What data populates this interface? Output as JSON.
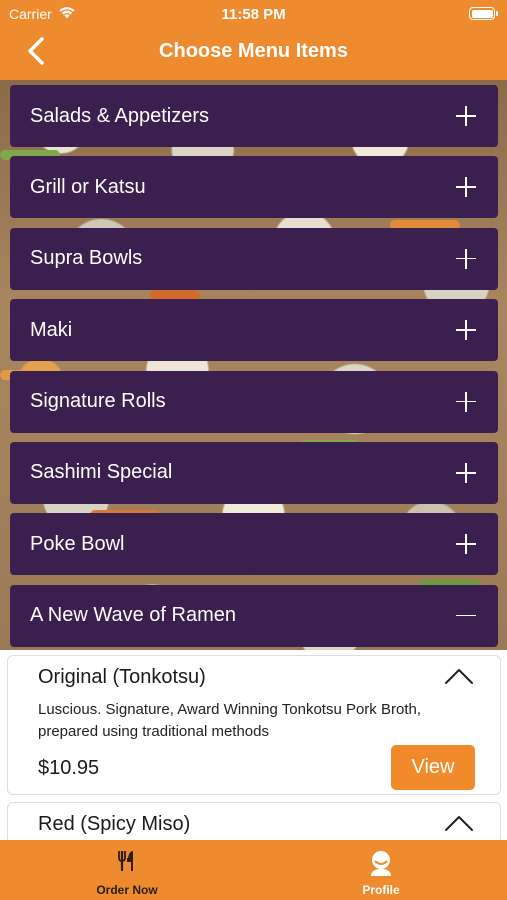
{
  "status_bar": {
    "carrier": "Carrier",
    "time": "11:58 PM"
  },
  "nav": {
    "title": "Choose Menu Items",
    "back_icon": "chevron-left-icon"
  },
  "categories": [
    {
      "label": "Salads & Appetizers",
      "state": "collapsed"
    },
    {
      "label": "Grill or Katsu",
      "state": "collapsed"
    },
    {
      "label": "Supra Bowls",
      "state": "collapsed"
    },
    {
      "label": "Maki",
      "state": "collapsed"
    },
    {
      "label": "Signature Rolls",
      "state": "collapsed"
    },
    {
      "label": "Sashimi Special",
      "state": "collapsed"
    },
    {
      "label": "Poke Bowl",
      "state": "collapsed"
    },
    {
      "label": "A New Wave of Ramen",
      "state": "expanded"
    }
  ],
  "items": [
    {
      "name": "Original (Tonkotsu)",
      "description": "Luscious. Signature, Award Winning Tonkotsu Pork Broth, prepared using traditional methods",
      "price": "$10.95",
      "view_label": "View"
    },
    {
      "name": "Red (Spicy Miso)"
    }
  ],
  "tabs": [
    {
      "label": "Order Now",
      "icon": "utensils-icon",
      "selected": true
    },
    {
      "label": "Profile",
      "icon": "person-icon",
      "selected": false
    }
  ],
  "colors": {
    "accent": "#ee8b2e",
    "category_bg": "#3b1f4e",
    "button": "#f18a2a"
  }
}
